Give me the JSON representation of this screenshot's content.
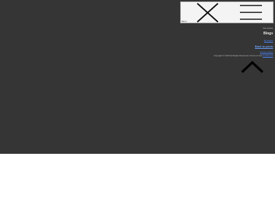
{
  "header": {
    "menu_label": "Menu",
    "close_icon": "close-icon",
    "menu_icon": "hamburger-menu-icon"
  },
  "footer": {
    "top_note": "Site details",
    "section_title": "Blogs",
    "sub_link": "By author",
    "action_link": "Back to posts",
    "small_link": "Privacy Policy",
    "copyright": "Copyright © 2023 All Rights Reserved | Terms of Use",
    "copyright_link": "Contact Us",
    "back_to_top_icon": "chevron-up-icon"
  },
  "colors": {
    "dark_background": "#353535",
    "header_background": "#f4f4f4",
    "link": "#4a86ff",
    "page_background": "#ffffff"
  }
}
